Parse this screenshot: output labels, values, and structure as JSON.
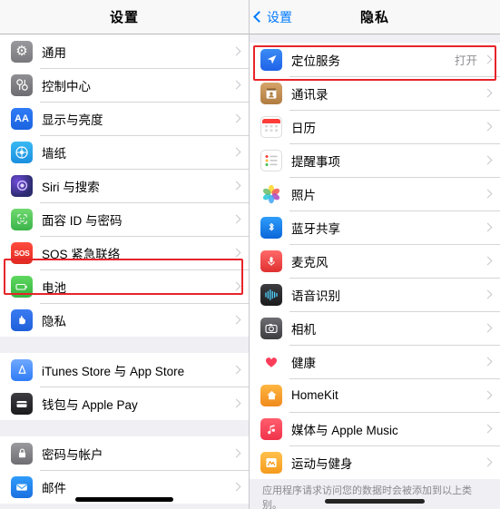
{
  "left_panel": {
    "nav_title": "设置",
    "groups": [
      {
        "rows": [
          {
            "label": "通用",
            "icon": "gear-icon",
            "value": ""
          },
          {
            "label": "控制中心",
            "icon": "control-center-icon",
            "value": ""
          },
          {
            "label": "显示与亮度",
            "icon": "display-brightness-icon",
            "value": ""
          },
          {
            "label": "墙纸",
            "icon": "wallpaper-icon",
            "value": ""
          },
          {
            "label": "Siri 与搜索",
            "icon": "siri-icon",
            "value": ""
          },
          {
            "label": "面容 ID 与密码",
            "icon": "face-id-icon",
            "value": ""
          },
          {
            "label": "SOS 紧急联络",
            "icon": "sos-icon",
            "value": ""
          },
          {
            "label": "电池",
            "icon": "battery-icon",
            "value": ""
          },
          {
            "label": "隐私",
            "icon": "privacy-icon",
            "value": "",
            "highlighted": true
          }
        ]
      },
      {
        "rows": [
          {
            "label": "iTunes Store 与 App Store",
            "icon": "itunes-store-icon",
            "value": ""
          },
          {
            "label": "钱包与 Apple Pay",
            "icon": "wallet-icon",
            "value": ""
          }
        ]
      },
      {
        "rows": [
          {
            "label": "密码与帐户",
            "icon": "passwords-accounts-icon",
            "value": ""
          },
          {
            "label": "邮件",
            "icon": "mail-icon",
            "value": ""
          }
        ]
      }
    ]
  },
  "right_panel": {
    "back_label": "设置",
    "nav_title": "隐私",
    "rows": [
      {
        "label": "定位服务",
        "icon": "location-services-icon",
        "value": "打开",
        "highlighted": true
      },
      {
        "label": "通讯录",
        "icon": "contacts-icon",
        "value": ""
      },
      {
        "label": "日历",
        "icon": "calendar-icon",
        "value": ""
      },
      {
        "label": "提醒事项",
        "icon": "reminders-icon",
        "value": ""
      },
      {
        "label": "照片",
        "icon": "photos-icon",
        "value": ""
      },
      {
        "label": "蓝牙共享",
        "icon": "bluetooth-icon",
        "value": ""
      },
      {
        "label": "麦克风",
        "icon": "microphone-icon",
        "value": ""
      },
      {
        "label": "语音识别",
        "icon": "speech-recognition-icon",
        "value": ""
      },
      {
        "label": "相机",
        "icon": "camera-icon",
        "value": ""
      },
      {
        "label": "健康",
        "icon": "health-icon",
        "value": ""
      },
      {
        "label": "HomeKit",
        "icon": "homekit-icon",
        "value": ""
      },
      {
        "label": "媒体与 Apple Music",
        "icon": "apple-music-icon",
        "value": ""
      },
      {
        "label": "运动与健身",
        "icon": "fitness-icon",
        "value": ""
      }
    ],
    "footer_note": "应用程序请求访问您的数据时会被添加到以上类别。"
  },
  "colors": {
    "accent_blue": "#007aff",
    "highlight_red": "#e8242a",
    "list_bg": "#ffffff",
    "group_bg": "#efeff4"
  }
}
